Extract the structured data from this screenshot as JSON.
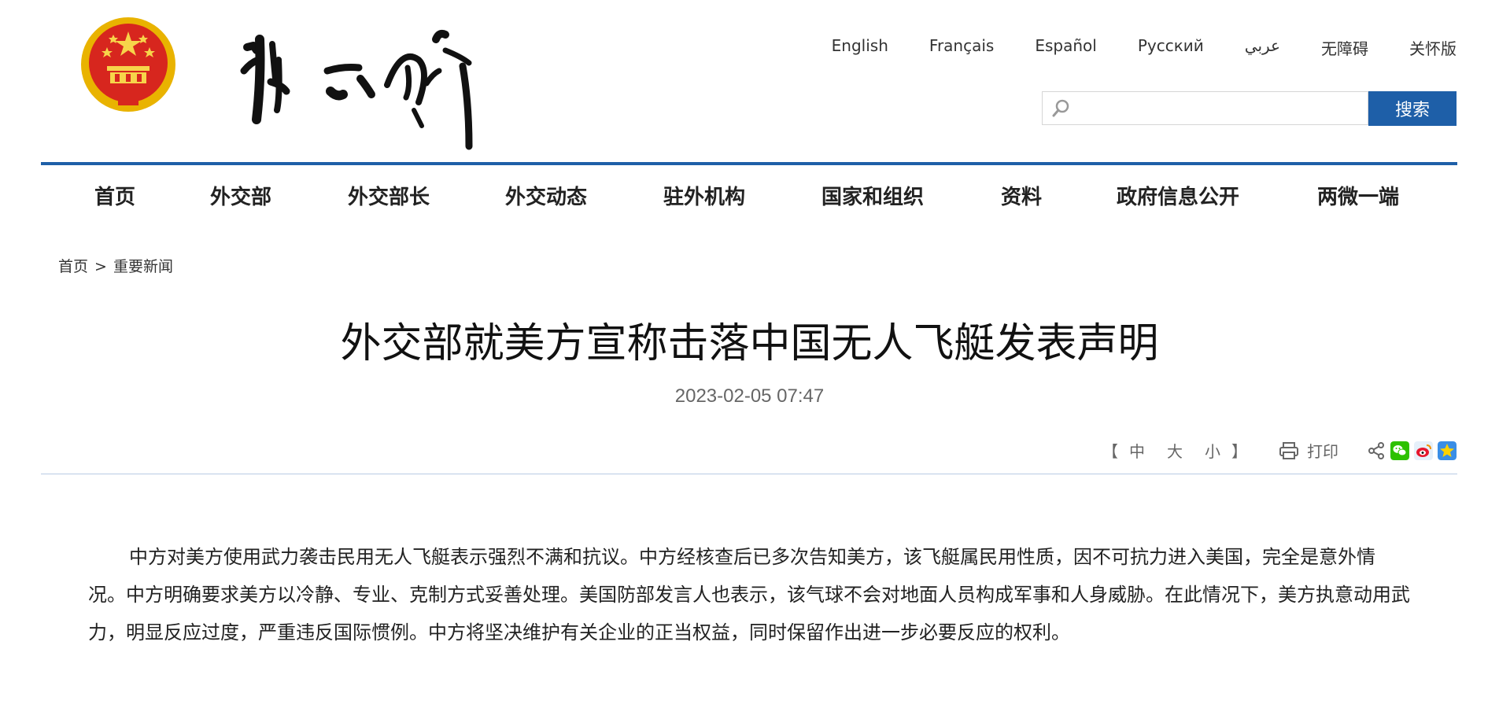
{
  "header": {
    "languages": [
      "English",
      "Français",
      "Español",
      "Русский",
      "عربي",
      "无障碍",
      "关怀版"
    ],
    "search": {
      "placeholder": "",
      "value": "",
      "button_label": "搜索"
    },
    "emblem_icon": "national-emblem",
    "logo_text": "外交部"
  },
  "nav": {
    "items": [
      "首页",
      "外交部",
      "外交部长",
      "外交动态",
      "驻外机构",
      "国家和组织",
      "资料",
      "政府信息公开",
      "两微一端"
    ]
  },
  "breadcrumb": {
    "home": "首页",
    "separator": ">",
    "current": "重要新闻"
  },
  "article": {
    "title": "外交部就美方宣称击落中国无人飞艇发表声明",
    "date": "2023-02-05 07:47",
    "font_size_controls": {
      "open": "【",
      "large": "中",
      "medium": "大",
      "small": "小",
      "close": "】"
    },
    "print_label": "打印",
    "share_icons": [
      "share-icon",
      "wechat-icon",
      "weibo-icon",
      "qzone-icon"
    ],
    "body": "中方对美方使用武力袭击民用无人飞艇表示强烈不满和抗议。中方经核查后已多次告知美方，该飞艇属民用性质，因不可抗力进入美国，完全是意外情况。中方明确要求美方以冷静、专业、克制方式妥善处理。美国防部发言人也表示，该气球不会对地面人员构成军事和人身威胁。在此情况下，美方执意动用武力，明显反应过度，严重违反国际惯例。中方将坚决维护有关企业的正当权益，同时保留作出进一步必要反应的权利。"
  },
  "colors": {
    "brand_blue": "#1e5fa8",
    "emblem_red": "#d7261e",
    "emblem_gold": "#f2c400"
  }
}
